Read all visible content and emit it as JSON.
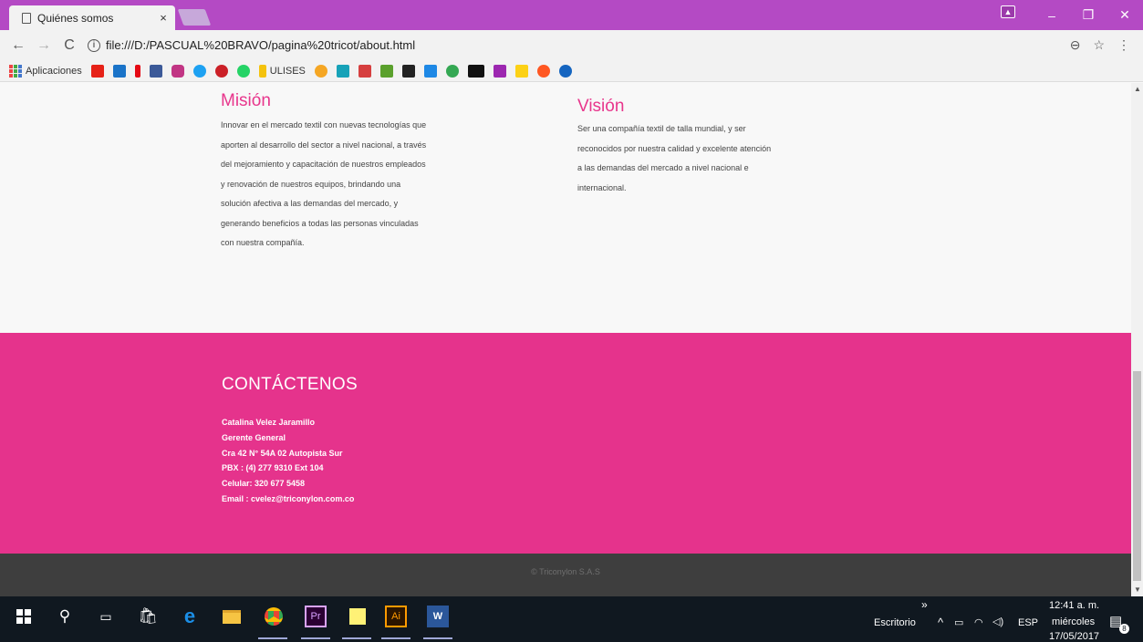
{
  "browser": {
    "tab_title": "Quiénes somos",
    "tab_close": "×",
    "url": "file:///D:/PASCUAL%20BRAVO/pagina%20tricot/about.html",
    "apps_label": "Aplicaciones",
    "bookmark_text": "ULISES"
  },
  "mision": {
    "title": "Misión",
    "text": "Innovar en el mercado textil con nuevas tecnologías que aporten al desarrollo del sector a nivel nacional, a través del mejoramiento y capacitación de nuestros empleados y renovación de nuestros equipos, brindando una solución afectiva a las demandas del mercado, y generando beneficios a todas las personas vinculadas con nuestra compañía."
  },
  "vision": {
    "title": "Visión",
    "text": "Ser una compañía textil de talla mundial, y ser reconocidos por nuestra calidad y excelente atención a las demandas del mercado a nivel nacional e internacional."
  },
  "contact": {
    "title": "CONTÁCTENOS",
    "name": "Catalina Velez Jaramillo",
    "role": "Gerente General",
    "address": "Cra 42 N° 54A 02 Autopista Sur",
    "pbx": "PBX : (4) 277 9310 Ext 104",
    "cell": "Celular: 320 677 5458",
    "email": "Email : cvelez@triconylon.com.co"
  },
  "footer": {
    "copyright": "© Triconylon S.A.S"
  },
  "taskbar": {
    "desktop_label": "Escritorio",
    "lang": "ESP",
    "time": "12:41 a. m.",
    "day": "miércoles",
    "date": "17/05/2017",
    "notifications": "8",
    "chevron": "»"
  },
  "colors": {
    "accent_pink": "#e5338c",
    "title_pink": "#e8368c",
    "titlebar": "#b44ac4",
    "footer": "#3e3e3e"
  }
}
